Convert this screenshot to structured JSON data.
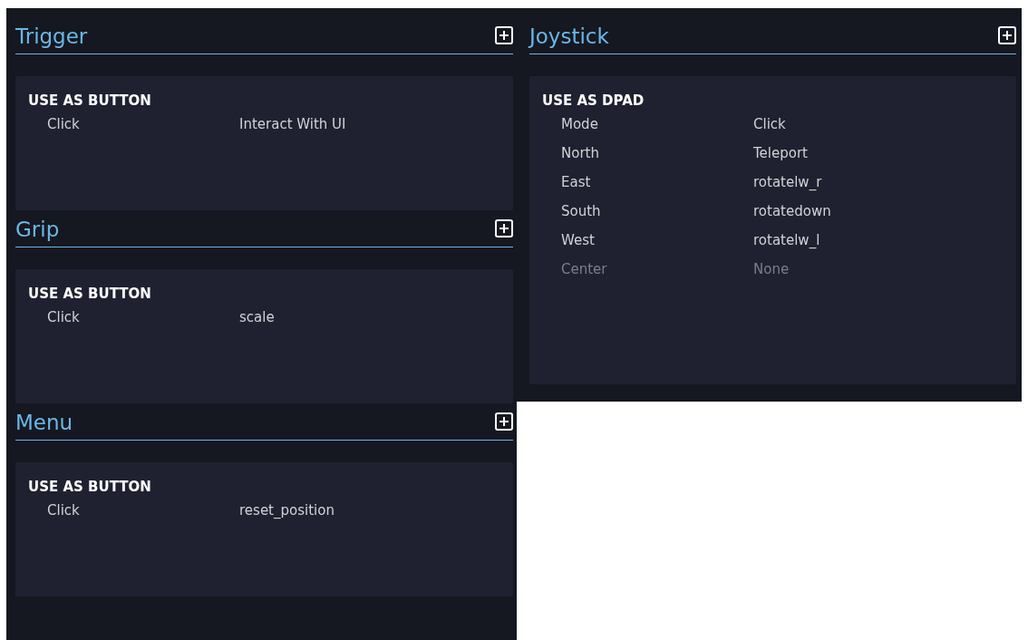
{
  "columns": [
    {
      "sections": [
        {
          "title": "Trigger",
          "groups": [
            {
              "heading": "USE AS BUTTON",
              "rows": [
                {
                  "label": "Click",
                  "value": "Interact With UI",
                  "disabled": false
                }
              ]
            }
          ]
        },
        {
          "title": "Grip",
          "groups": [
            {
              "heading": "USE AS BUTTON",
              "rows": [
                {
                  "label": "Click",
                  "value": "scale",
                  "disabled": false
                }
              ]
            }
          ]
        },
        {
          "title": "Menu",
          "groups": [
            {
              "heading": "USE AS BUTTON",
              "rows": [
                {
                  "label": "Click",
                  "value": "reset_position",
                  "disabled": false
                }
              ]
            }
          ]
        }
      ]
    },
    {
      "sections": [
        {
          "title": "Joystick",
          "groups": [
            {
              "heading": "USE AS DPAD",
              "rows": [
                {
                  "label": "Mode",
                  "value": "Click",
                  "disabled": false
                },
                {
                  "label": "North",
                  "value": "Teleport",
                  "disabled": false
                },
                {
                  "label": "East",
                  "value": "rotatelw_r",
                  "disabled": false
                },
                {
                  "label": "South",
                  "value": "rotatedown",
                  "disabled": false
                },
                {
                  "label": "West",
                  "value": "rotatelw_l",
                  "disabled": false
                },
                {
                  "label": "Center",
                  "value": "None",
                  "disabled": true
                }
              ]
            }
          ]
        }
      ]
    }
  ]
}
